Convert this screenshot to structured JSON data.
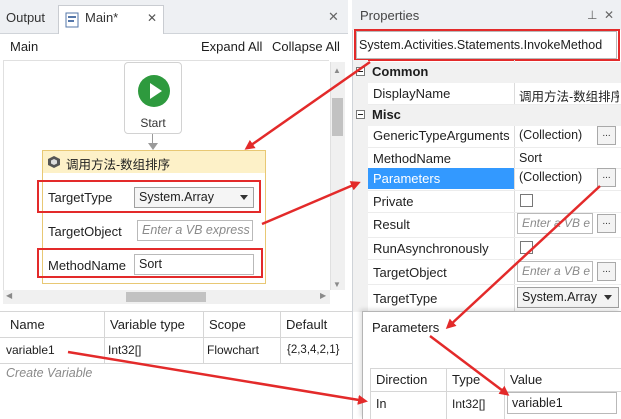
{
  "tabs": {
    "output": "Output",
    "main": "Main*",
    "close_glyph": "✕"
  },
  "designer": {
    "title": "Main",
    "expand_all": "Expand All",
    "collapse_all": "Collapse All",
    "start_label": "Start",
    "activity": {
      "title": "调用方法-数组排序",
      "target_type_label": "TargetType",
      "target_type_value": "System.Array",
      "target_object_label": "TargetObject",
      "target_object_placeholder": "Enter a VB express",
      "method_name_label": "MethodName",
      "method_name_value": "Sort"
    }
  },
  "variables": {
    "columns": [
      "Name",
      "Variable type",
      "Scope",
      "Default"
    ],
    "rows": [
      {
        "name": "variable1",
        "type": "Int32[]",
        "scope": "Flowchart",
        "default": "{2,3,4,2,1}"
      }
    ],
    "create_label": "Create Variable"
  },
  "properties": {
    "title": "Properties",
    "pin_glyph": "⊥",
    "close_glyph": "✕",
    "activity_type": "System.Activities.Statements.InvokeMethod",
    "categories": {
      "common": "Common",
      "misc": "Misc"
    },
    "rows": {
      "display_name": {
        "label": "DisplayName",
        "value": "调用方法-数组排序"
      },
      "generic_type_arguments": {
        "label": "GenericTypeArguments",
        "value": "(Collection)"
      },
      "method_name": {
        "label": "MethodName",
        "value": "Sort"
      },
      "parameters": {
        "label": "Parameters",
        "value": "(Collection)"
      },
      "private": {
        "label": "Private"
      },
      "result": {
        "label": "Result",
        "placeholder": "Enter a VB e"
      },
      "run_async": {
        "label": "RunAsynchronously"
      },
      "target_object": {
        "label": "TargetObject",
        "placeholder": "Enter a VB e"
      },
      "target_type": {
        "label": "TargetType",
        "value": "System.Array"
      }
    },
    "ellipsis": "..."
  },
  "parameters_dialog": {
    "title": "Parameters",
    "columns": [
      "Direction",
      "Type",
      "Value"
    ],
    "rows": [
      {
        "direction": "In",
        "type": "Int32[]",
        "value": "variable1"
      }
    ]
  },
  "colors": {
    "highlight_red": "#e32a2a",
    "selection_blue": "#3399ff",
    "start_green": "#2e9a3e",
    "activity_header": "#fdf1c8"
  }
}
